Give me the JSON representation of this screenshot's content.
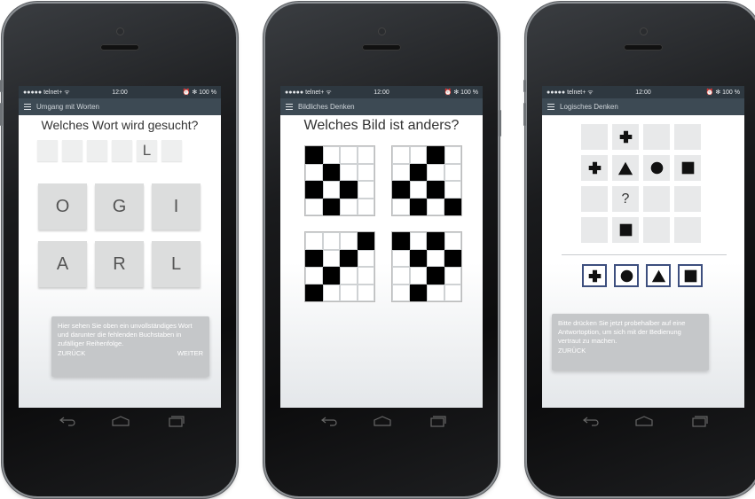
{
  "statusbar": {
    "carrier": "●●●●● telnet+ ᯤ",
    "time": "12:00",
    "battery": "⏰ ✻ 100 %"
  },
  "phones": [
    {
      "section": "Umgang mit Worten",
      "title": "Welches Wort wird gesucht?",
      "slots": [
        "",
        "",
        "",
        "",
        "L",
        ""
      ],
      "keys": [
        "O",
        "G",
        "I",
        "A",
        "R",
        "L"
      ],
      "tip": {
        "text": "Hier sehen Sie oben ein unvollständiges Wort und darunter die fehlenden Buchstaben in zufälliger Reihenfolge.",
        "back": "ZURÜCK",
        "next": "WEITER"
      }
    },
    {
      "section": "Bildliches Denken",
      "title": "Welches Bild ist anders?",
      "figures": [
        [
          [
            1,
            0,
            0,
            0
          ],
          [
            0,
            1,
            0,
            0
          ],
          [
            1,
            0,
            1,
            0
          ],
          [
            0,
            1,
            0,
            0
          ]
        ],
        [
          [
            0,
            0,
            1,
            0
          ],
          [
            0,
            1,
            0,
            0
          ],
          [
            1,
            0,
            1,
            0
          ],
          [
            0,
            1,
            0,
            1
          ]
        ],
        [
          [
            0,
            0,
            0,
            1
          ],
          [
            1,
            0,
            1,
            0
          ],
          [
            0,
            1,
            0,
            0
          ],
          [
            1,
            0,
            0,
            0
          ]
        ],
        [
          [
            1,
            0,
            1,
            0
          ],
          [
            0,
            1,
            0,
            1
          ],
          [
            0,
            0,
            1,
            0
          ],
          [
            0,
            1,
            0,
            0
          ]
        ]
      ]
    },
    {
      "section": "Logisches Denken",
      "matrix": [
        [
          "",
          "cross",
          "",
          ""
        ],
        [
          "cross",
          "triangle",
          "circle",
          "square"
        ],
        [
          "",
          "?",
          "",
          ""
        ],
        [
          "",
          "square",
          "",
          ""
        ]
      ],
      "options": [
        "cross",
        "circle",
        "triangle",
        "square"
      ],
      "tip": {
        "text": "Bitte drücken Sie jetzt probehalber auf eine Antwortoption, um sich mit der Bedienung vertraut zu machen.",
        "back": "ZURÜCK"
      }
    }
  ],
  "navbar": {
    "icons": [
      "back-icon",
      "home-icon",
      "recent-apps-icon"
    ]
  },
  "colors": {
    "statusbar": "#2e3840",
    "appbar": "#3d4a54",
    "option_border": "#3d4f7e",
    "key": "#dcdddd"
  }
}
